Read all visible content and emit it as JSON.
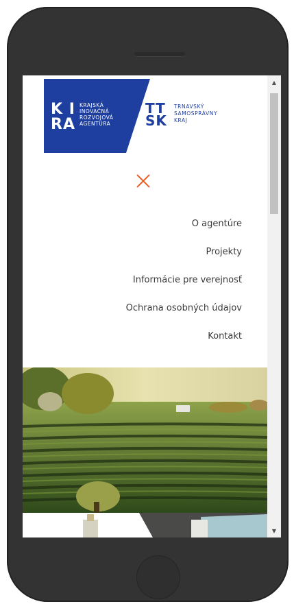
{
  "logos": {
    "kira_big_line1": "K I",
    "kira_big_line2": "RA",
    "kira_small": [
      "KRAJSKÁ",
      "INOVAČNÁ",
      "ROZVOJOVÁ",
      "AGENTÚRA"
    ],
    "ttsk_big_line1": "TT",
    "ttsk_big_line2": "SK",
    "ttsk_small": [
      "TRNAVSKÝ",
      "SAMOSPRÁVNY",
      "KRAJ"
    ]
  },
  "colors": {
    "brand_blue": "#1e3fa0",
    "close_orange": "#e8612c",
    "nav_text": "#3a3a3a"
  },
  "icons": {
    "close": "close-icon",
    "scroll_up": "scroll-up-arrow-icon",
    "scroll_down": "scroll-down-arrow-icon"
  },
  "nav": {
    "items": [
      {
        "label": "O agentúre"
      },
      {
        "label": "Projekty"
      },
      {
        "label": "Informácie pre verejnosť"
      },
      {
        "label": "Ochrana osobných údajov"
      },
      {
        "label": "Kontakt"
      }
    ]
  },
  "scroll": {
    "thumb_position": 0.0
  }
}
